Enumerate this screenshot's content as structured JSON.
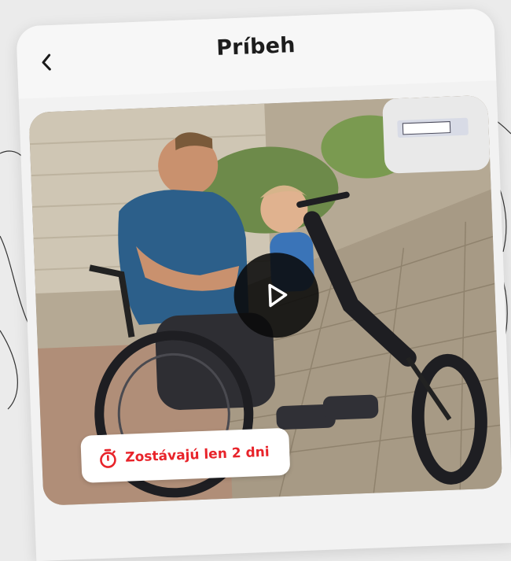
{
  "header": {
    "title": "Príbeh",
    "back_icon": "chevron-left-icon"
  },
  "media": {
    "play_icon": "play-icon",
    "badge": {
      "icon": "stopwatch-icon",
      "text": "Zostávajú len 2 dni",
      "color": "#e8232a"
    }
  }
}
